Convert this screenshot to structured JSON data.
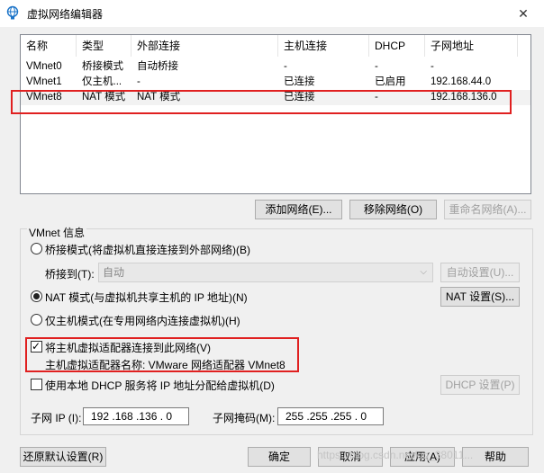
{
  "window": {
    "title": "虚拟网络编辑器",
    "close_glyph": "✕"
  },
  "table": {
    "headers": [
      "名称",
      "类型",
      "外部连接",
      "主机连接",
      "DHCP",
      "子网地址"
    ],
    "rows": [
      [
        "VMnet0",
        "桥接模式",
        "自动桥接",
        "-",
        "-",
        "-"
      ],
      [
        "VMnet1",
        "仅主机...",
        "-",
        "已连接",
        "已启用",
        "192.168.44.0"
      ],
      [
        "VMnet8",
        "NAT 模式",
        "NAT 模式",
        "已连接",
        "-",
        "192.168.136.0"
      ]
    ]
  },
  "buttons": {
    "add_network": "添加网络(E)...",
    "remove_network": "移除网络(O)",
    "rename_network": "重命名网络(A)...",
    "auto_settings": "自动设置(U)...",
    "nat_settings": "NAT 设置(S)...",
    "dhcp_settings": "DHCP 设置(P)",
    "restore_defaults": "还原默认设置(R)",
    "ok": "确定",
    "cancel": "取消",
    "apply": "应用(A)",
    "help": "帮助"
  },
  "vmnet_info": {
    "group_title": "VMnet 信息",
    "bridged_label": "桥接模式(将虚拟机直接连接到外部网络)(B)",
    "bridged_to_label": "桥接到(T):",
    "bridged_to_value": "自动",
    "nat_label": "NAT 模式(与虚拟机共享主机的 IP 地址)(N)",
    "host_only_label": "仅主机模式(在专用网络内连接虚拟机)(H)",
    "selected_mode": "nat",
    "connect_adapter_label": "将主机虚拟适配器连接到此网络(V)",
    "connect_adapter_checked": true,
    "adapter_name_label": "主机虚拟适配器名称: VMware 网络适配器 VMnet8",
    "dhcp_label": "使用本地 DHCP 服务将 IP 地址分配给虚拟机(D)",
    "dhcp_checked": false,
    "subnet_ip_label": "子网 IP (I):",
    "subnet_ip_value": "192 .168 .136 . 0",
    "subnet_mask_label": "子网掩码(M):",
    "subnet_mask_value": "255 .255 .255 . 0"
  },
  "watermark": "https://blog.csdn.net/qq_38011..."
}
